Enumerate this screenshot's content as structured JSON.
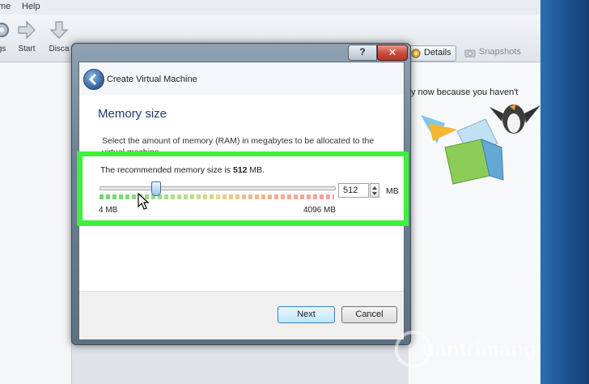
{
  "menubar": {
    "items": [
      "me",
      "Help"
    ]
  },
  "toolbar": {
    "buttons": [
      {
        "label": "gs",
        "icon": "settings-gear-icon"
      },
      {
        "label": "Start",
        "icon": "start-arrow-icon"
      },
      {
        "label": "Disca",
        "icon": "discard-arrow-down-icon"
      }
    ],
    "details_label": "Details",
    "snapshots_label": "Snapshots"
  },
  "welcome": {
    "text": "y now because you haven't"
  },
  "dialog": {
    "title": "Create Virtual Machine",
    "help_label": "?",
    "close_label": "✕",
    "section_title": "Memory size",
    "description": "Select the amount of memory (RAM) in megabytes to be allocated to the virtual machine.",
    "recommended_prefix": "The recommended memory size is ",
    "recommended_value": "512",
    "recommended_suffix": " MB.",
    "slider": {
      "min_label": "4 MB",
      "max_label": "4096 MB",
      "min": 4,
      "max": 4096,
      "value": 512
    },
    "memory_input_value": "512",
    "unit_label": "MB",
    "next_label": "Next",
    "cancel_label": "Cancel"
  },
  "watermark": {
    "text": "uantrimang"
  },
  "colors": {
    "highlight": "#3cf03c",
    "title_blue": "#1c3c6e",
    "close_red": "#c94a3a"
  }
}
